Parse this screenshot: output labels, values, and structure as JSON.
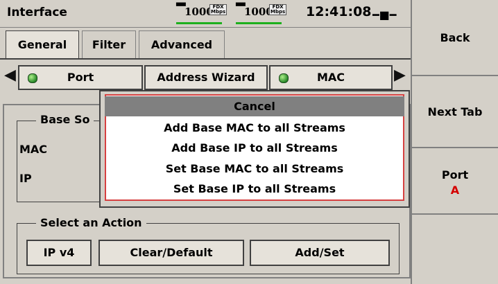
{
  "header": {
    "title": "Interface",
    "speed1": "1000",
    "speed1_tag": "FDX",
    "speed1_unit": "Mbps",
    "speed2": "1000",
    "speed2_tag": "FDX",
    "speed2_unit": "Mbps",
    "time": "12:41:08"
  },
  "tabs": [
    {
      "label": "General",
      "active": true
    },
    {
      "label": "Filter",
      "active": false
    },
    {
      "label": "Advanced",
      "active": false
    }
  ],
  "port_row": {
    "port_label": "Port",
    "wizard_label": "Address Wizard",
    "mac_label": "MAC"
  },
  "base_section": {
    "legend": "Base So",
    "mac_label": "MAC",
    "ip_label": "IP"
  },
  "action_section": {
    "legend": "Select an Action",
    "buttons": [
      "IP v4",
      "Clear/Default",
      "Add/Set"
    ]
  },
  "sidebar": {
    "back": "Back",
    "next_tab": "Next Tab",
    "port": "Port",
    "port_value": "A"
  },
  "popup_menu": {
    "items": [
      "Cancel",
      "Add Base MAC to all Streams",
      "Add Base IP to all Streams",
      "Set Base MAC to all Streams",
      "Set Base IP to all Streams"
    ]
  },
  "colors": {
    "background": "#d4d0c8",
    "accent_red": "#d40000",
    "led_green": "#2a8a2a",
    "link_bar": "#1db01d",
    "menu_highlight": "#808080"
  }
}
